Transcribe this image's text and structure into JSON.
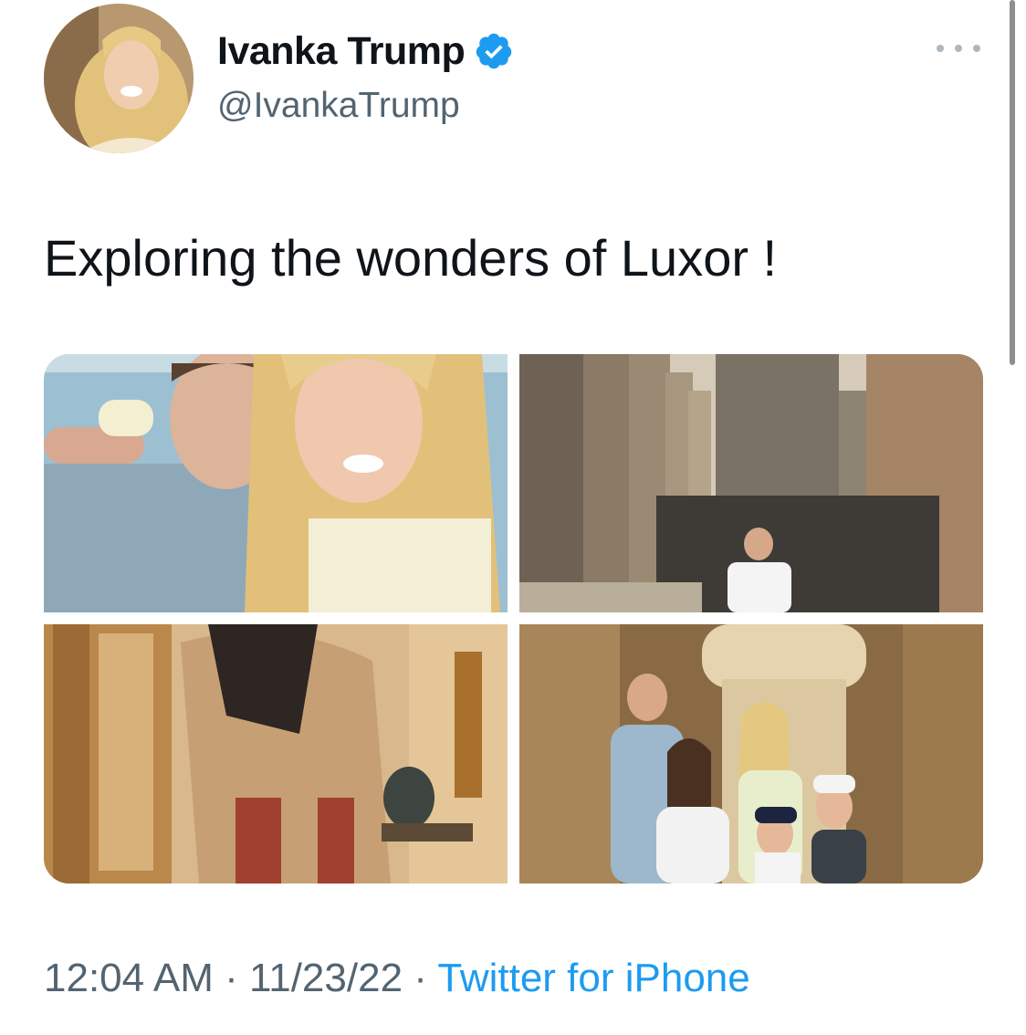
{
  "tweet": {
    "author": {
      "display_name": "Ivanka Trump",
      "handle": "@IvankaTrump",
      "verified": true,
      "avatar_icon": "profile-photo"
    },
    "text": "Exploring the wonders of Luxor !",
    "media": [
      {
        "name": "couple-selfie-photo"
      },
      {
        "name": "temple-columns-statue-photo"
      },
      {
        "name": "hieroglyph-wall-painting-photo"
      },
      {
        "name": "family-temple-photo"
      }
    ],
    "time": "12:04 AM",
    "separator": "·",
    "date": "11/23/22",
    "source": "Twitter for iPhone",
    "more_icon": "ellipsis-icon"
  },
  "colors": {
    "text_primary": "#0f1419",
    "text_secondary": "#536471",
    "link": "#1d9bf0",
    "verified": "#1d9bf0"
  }
}
